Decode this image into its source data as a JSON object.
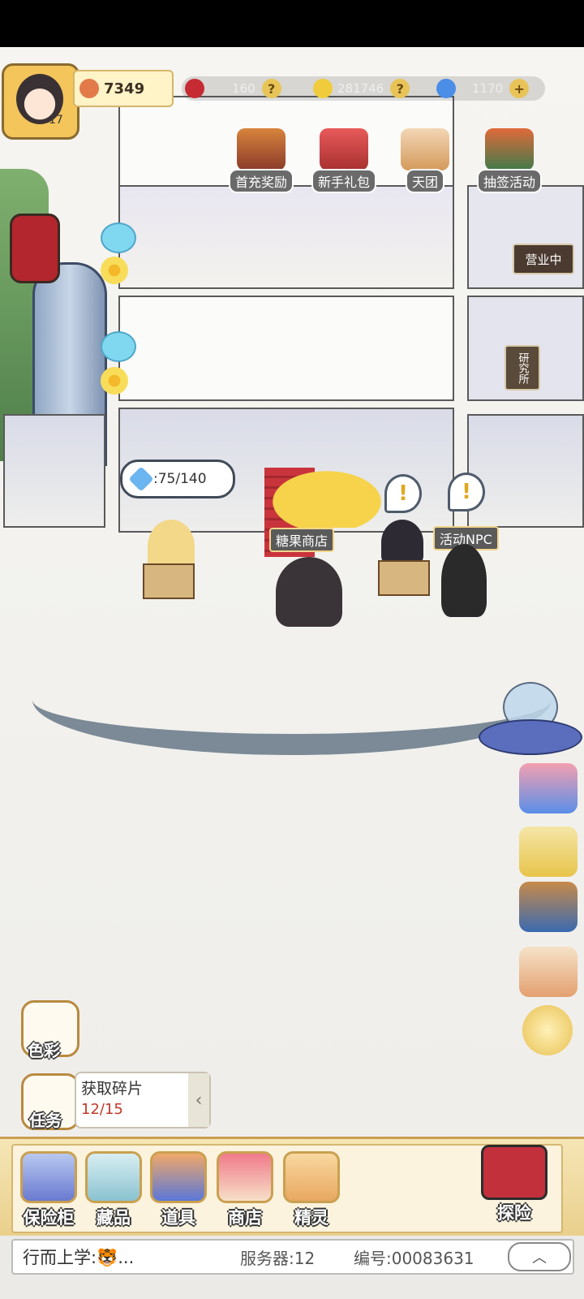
{
  "player": {
    "level": "17",
    "coins": "7349"
  },
  "resources": [
    {
      "name": "heart",
      "value": "160",
      "color": "#c62b33"
    },
    {
      "name": "flower",
      "value": "281746",
      "color": "#f0cc3c"
    },
    {
      "name": "diamond",
      "value": "1170",
      "color": "#4b8ee8"
    }
  ],
  "top_buttons": [
    "首充奖励",
    "新手礼包",
    "天团",
    "抽签活动"
  ],
  "signs": {
    "shop_open": "营业中",
    "research": "研究所"
  },
  "energy": {
    "value": ":75/140"
  },
  "npcs": {
    "candy_shop": "糖果商店",
    "event_npc": "活动NPC",
    "exclaim": "!"
  },
  "left_buttons": {
    "color": "色彩",
    "task": "任务"
  },
  "task": {
    "title": "获取碎片",
    "progress": "12/15",
    "arrow": "‹"
  },
  "bottom_menu": [
    "保险柜",
    "藏品",
    "道具",
    "商店",
    "精灵"
  ],
  "explore": "探险",
  "chat": {
    "message": "行而上学:🐯...",
    "server": "服务器:12",
    "id": "编号:00083631",
    "up": "︿"
  },
  "plus": "+",
  "question": "?"
}
